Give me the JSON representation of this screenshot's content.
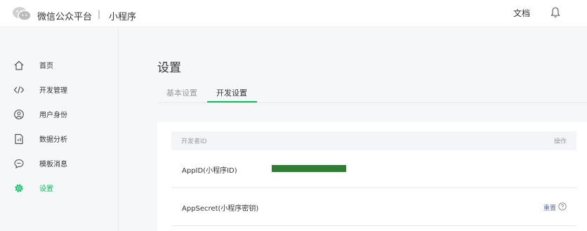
{
  "header": {
    "brand": "微信公众平台",
    "separator": "|",
    "product": "小程序",
    "docs_label": "文档"
  },
  "sidebar": {
    "items": [
      {
        "label": "首页",
        "icon": "home-icon"
      },
      {
        "label": "开发管理",
        "icon": "code-icon"
      },
      {
        "label": "用户身份",
        "icon": "user-circle-icon"
      },
      {
        "label": "数据分析",
        "icon": "document-chart-icon"
      },
      {
        "label": "模板消息",
        "icon": "chat-bubble-icon"
      },
      {
        "label": "设置",
        "icon": "gear-icon",
        "active": true
      }
    ]
  },
  "main": {
    "title": "设置",
    "tabs": [
      {
        "label": "基本设置"
      },
      {
        "label": "开发设置",
        "active": true
      }
    ],
    "table": {
      "columns": [
        "开发者ID",
        "操作"
      ],
      "rows": [
        {
          "label": "AppID(小程序ID)",
          "value_redacted": true
        },
        {
          "label": "AppSecret(小程序密钥)",
          "action": "重置"
        }
      ]
    }
  },
  "colors": {
    "accent": "#07c160",
    "redaction": "#2e7d32",
    "link": "#576b95",
    "sidebar_bg": "#f6f7f9"
  }
}
